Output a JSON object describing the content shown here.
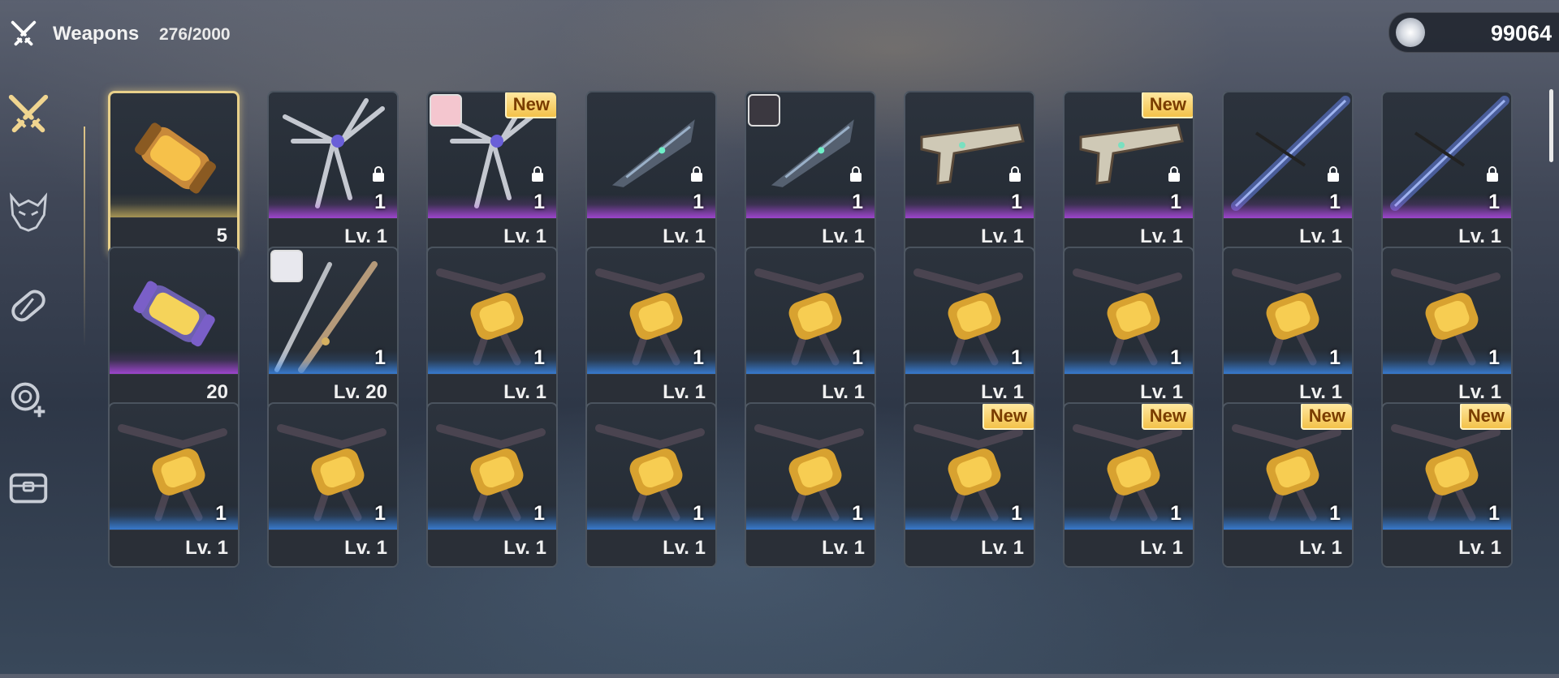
{
  "header": {
    "title": "Weapons",
    "count": "276/2000",
    "currency_value": "99064",
    "icon": "crossed-swords-icon"
  },
  "sidebar": [
    {
      "name": "weapons",
      "icon": "crossed-swords-icon",
      "active": true
    },
    {
      "name": "echoes",
      "icon": "beast-mask-icon",
      "active": false
    },
    {
      "name": "consumables",
      "icon": "pill-icon",
      "active": false
    },
    {
      "name": "materials",
      "icon": "gear-plus-icon",
      "active": false
    },
    {
      "name": "chest",
      "icon": "chest-icon",
      "active": false
    }
  ],
  "items": [
    {
      "type": "tube-gold",
      "rarity": "gold",
      "level": "",
      "qty": "5",
      "selected": true
    },
    {
      "type": "wing-blade",
      "rarity": "purple",
      "level": "Lv. 1",
      "qty": "1",
      "lock": true
    },
    {
      "type": "wing-blade",
      "rarity": "purple",
      "level": "Lv. 1",
      "qty": "1",
      "lock": true,
      "new": "New",
      "avatar": "pink"
    },
    {
      "type": "dark-blade",
      "rarity": "purple",
      "level": "Lv. 1",
      "qty": "1",
      "lock": true
    },
    {
      "type": "dark-blade",
      "rarity": "purple",
      "level": "Lv. 1",
      "qty": "1",
      "lock": true,
      "avatar": "dark"
    },
    {
      "type": "pistol",
      "rarity": "purple",
      "level": "Lv. 1",
      "qty": "1",
      "lock": true
    },
    {
      "type": "pistol",
      "rarity": "purple",
      "level": "Lv. 1",
      "qty": "1",
      "lock": true,
      "new": "New"
    },
    {
      "type": "spear",
      "rarity": "purple",
      "level": "Lv. 1",
      "qty": "1",
      "lock": true
    },
    {
      "type": "spear",
      "rarity": "purple",
      "level": "Lv. 1",
      "qty": "1",
      "lock": true
    },
    {
      "type": "tube-purple",
      "rarity": "purple",
      "level": "",
      "qty": "20"
    },
    {
      "type": "sword",
      "rarity": "blue",
      "level": "Lv. 20",
      "qty": "1",
      "avatar": "white"
    },
    {
      "type": "gauntlet",
      "rarity": "blue",
      "level": "Lv. 1",
      "qty": "1"
    },
    {
      "type": "gauntlet",
      "rarity": "blue",
      "level": "Lv. 1",
      "qty": "1"
    },
    {
      "type": "gauntlet",
      "rarity": "blue",
      "level": "Lv. 1",
      "qty": "1"
    },
    {
      "type": "gauntlet",
      "rarity": "blue",
      "level": "Lv. 1",
      "qty": "1"
    },
    {
      "type": "gauntlet",
      "rarity": "blue",
      "level": "Lv. 1",
      "qty": "1"
    },
    {
      "type": "gauntlet",
      "rarity": "blue",
      "level": "Lv. 1",
      "qty": "1"
    },
    {
      "type": "gauntlet",
      "rarity": "blue",
      "level": "Lv. 1",
      "qty": "1"
    },
    {
      "type": "gauntlet",
      "rarity": "blue",
      "level": "Lv. 1",
      "qty": "1"
    },
    {
      "type": "gauntlet",
      "rarity": "blue",
      "level": "Lv. 1",
      "qty": "1"
    },
    {
      "type": "gauntlet",
      "rarity": "blue",
      "level": "Lv. 1",
      "qty": "1"
    },
    {
      "type": "gauntlet",
      "rarity": "blue",
      "level": "Lv. 1",
      "qty": "1"
    },
    {
      "type": "gauntlet",
      "rarity": "blue",
      "level": "Lv. 1",
      "qty": "1"
    },
    {
      "type": "gauntlet",
      "rarity": "blue",
      "level": "Lv. 1",
      "qty": "1",
      "new": "New"
    },
    {
      "type": "gauntlet",
      "rarity": "blue",
      "level": "Lv. 1",
      "qty": "1",
      "new": "New"
    },
    {
      "type": "gauntlet",
      "rarity": "blue",
      "level": "Lv. 1",
      "qty": "1",
      "new": "New"
    },
    {
      "type": "gauntlet",
      "rarity": "blue",
      "level": "Lv. 1",
      "qty": "1",
      "new": "New"
    }
  ],
  "colors": {
    "gold": "#e8d08a",
    "purple": "#b94bf0",
    "blue": "#3c8cf0",
    "new_badge": "#f3c24a"
  }
}
